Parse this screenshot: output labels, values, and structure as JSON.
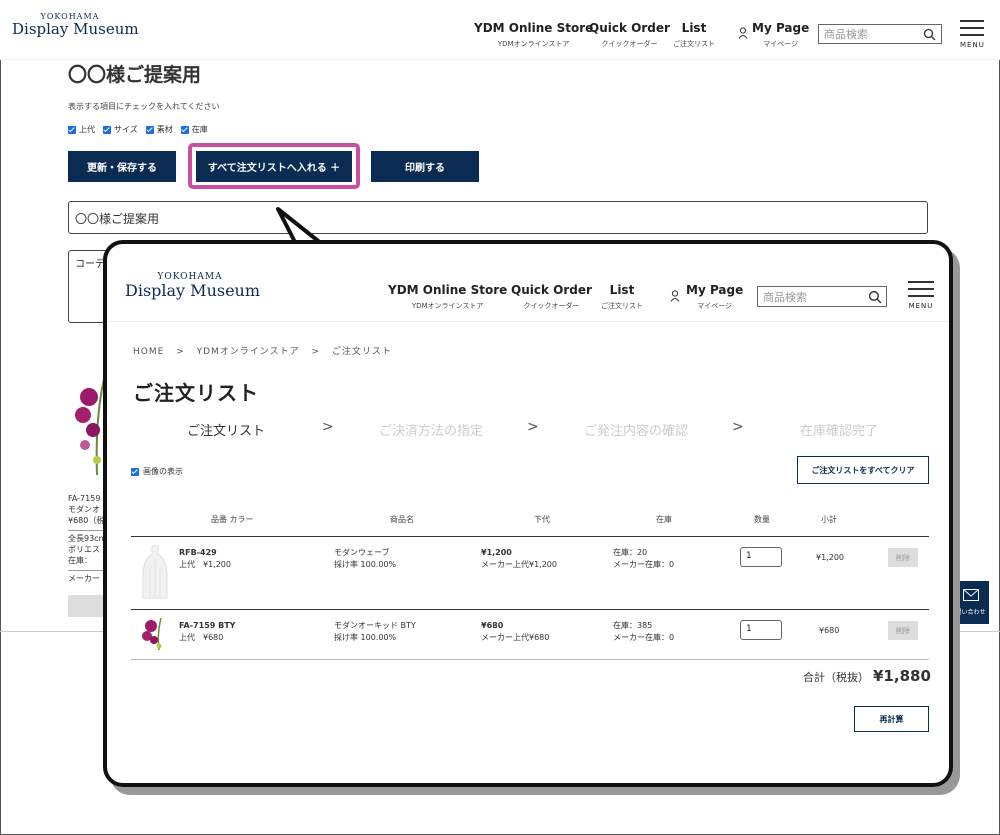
{
  "header": {
    "logo_top": "YOKOHAMA",
    "logo_main": "Display Museum",
    "nav": [
      {
        "label": "YDM Online Store",
        "sub": "YDMオンラインストア"
      },
      {
        "label": "Quick Order",
        "sub": "クイックオーダー"
      },
      {
        "label": "List",
        "sub": "ご注文リスト"
      },
      {
        "label": "My Page",
        "sub": "マイページ"
      }
    ],
    "search_placeholder": "商品検索",
    "menu_label": "MENU"
  },
  "background": {
    "title": "〇〇様ご提案用",
    "note": "表示する項目にチェックを入れてください",
    "checkboxes": [
      "上代",
      "サイズ",
      "素材",
      "在庫"
    ],
    "buttons": {
      "update": "更新・保存する",
      "add_all": "すべて注文リストへ入れる ＋",
      "print": "印刷する"
    },
    "name_input": "〇〇様ご提案用",
    "textarea": "コーデ",
    "product_lines": [
      "FA-7159",
      "モダンオ",
      "¥680（税",
      "全長93cm",
      "ポリエス",
      "在庫：",
      "メーカー"
    ],
    "contact_label": "問い合わせ"
  },
  "cart": {
    "breadcrumb": [
      "HOME",
      ">",
      "YDMオンラインストア",
      ">",
      "ご注文リスト"
    ],
    "title": "ご注文リスト",
    "steps": [
      "ご注文リスト",
      "ご決済方法の指定",
      "ご発注内容の確認",
      "在庫確認完了"
    ],
    "step_sep": ">",
    "show_images_label": "画像の表示",
    "clear_button": "ご注文リストをすべてクリア",
    "columns": [
      "品番 カラー",
      "商品名",
      "下代",
      "在庫",
      "数量",
      "小計"
    ],
    "items": [
      {
        "code": "RFB-429",
        "retail": "上代　¥1,200",
        "name": "モダンウェーブ",
        "material": "採け率 100.00%",
        "price": "¥1,200",
        "maker_price": "メーカー上代¥1,200",
        "stock": "在庫：20",
        "maker_stock": "メーカー在庫：0",
        "qty": "1",
        "subtotal": "¥1,200",
        "delete": "削除"
      },
      {
        "code": "FA-7159 BTY",
        "retail": "上代　¥680",
        "name": "モダンオーキッド BTY",
        "material": "採け率 100.00%",
        "price": "¥680",
        "maker_price": "メーカー上代¥680",
        "stock": "在庫：385",
        "maker_stock": "メーカー在庫：0",
        "qty": "1",
        "subtotal": "¥680",
        "delete": "削除"
      }
    ],
    "total_label": "合計（税抜）",
    "total_value": "¥1,880",
    "recalc_button": "再計算"
  },
  "colors": {
    "navy": "#0a2b52",
    "highlight": "#c94fa3"
  }
}
